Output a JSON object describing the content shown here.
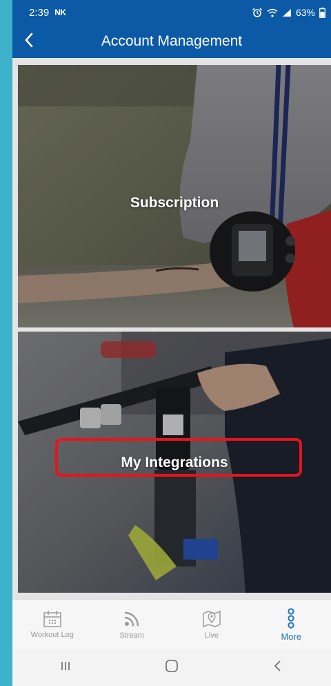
{
  "status_bar": {
    "time": "2:39",
    "app_badge": "NK",
    "battery": "63%"
  },
  "header": {
    "title": "Account Management",
    "back_icon": "chevron-left-icon"
  },
  "cards": [
    {
      "label": "Subscription"
    },
    {
      "label": "My Integrations"
    }
  ],
  "tabs": [
    {
      "label": "Workout Log",
      "icon": "calendar-icon",
      "active": false
    },
    {
      "label": "Stream",
      "icon": "signal-icon",
      "active": false
    },
    {
      "label": "Live",
      "icon": "map-pin-icon",
      "active": false
    },
    {
      "label": "More",
      "icon": "more-icon",
      "active": true
    }
  ],
  "colors": {
    "primary": "#0c5aa6",
    "active_tab": "#1d73c9",
    "highlight": "#e8141c",
    "outer_background": "#3fb2cb"
  }
}
